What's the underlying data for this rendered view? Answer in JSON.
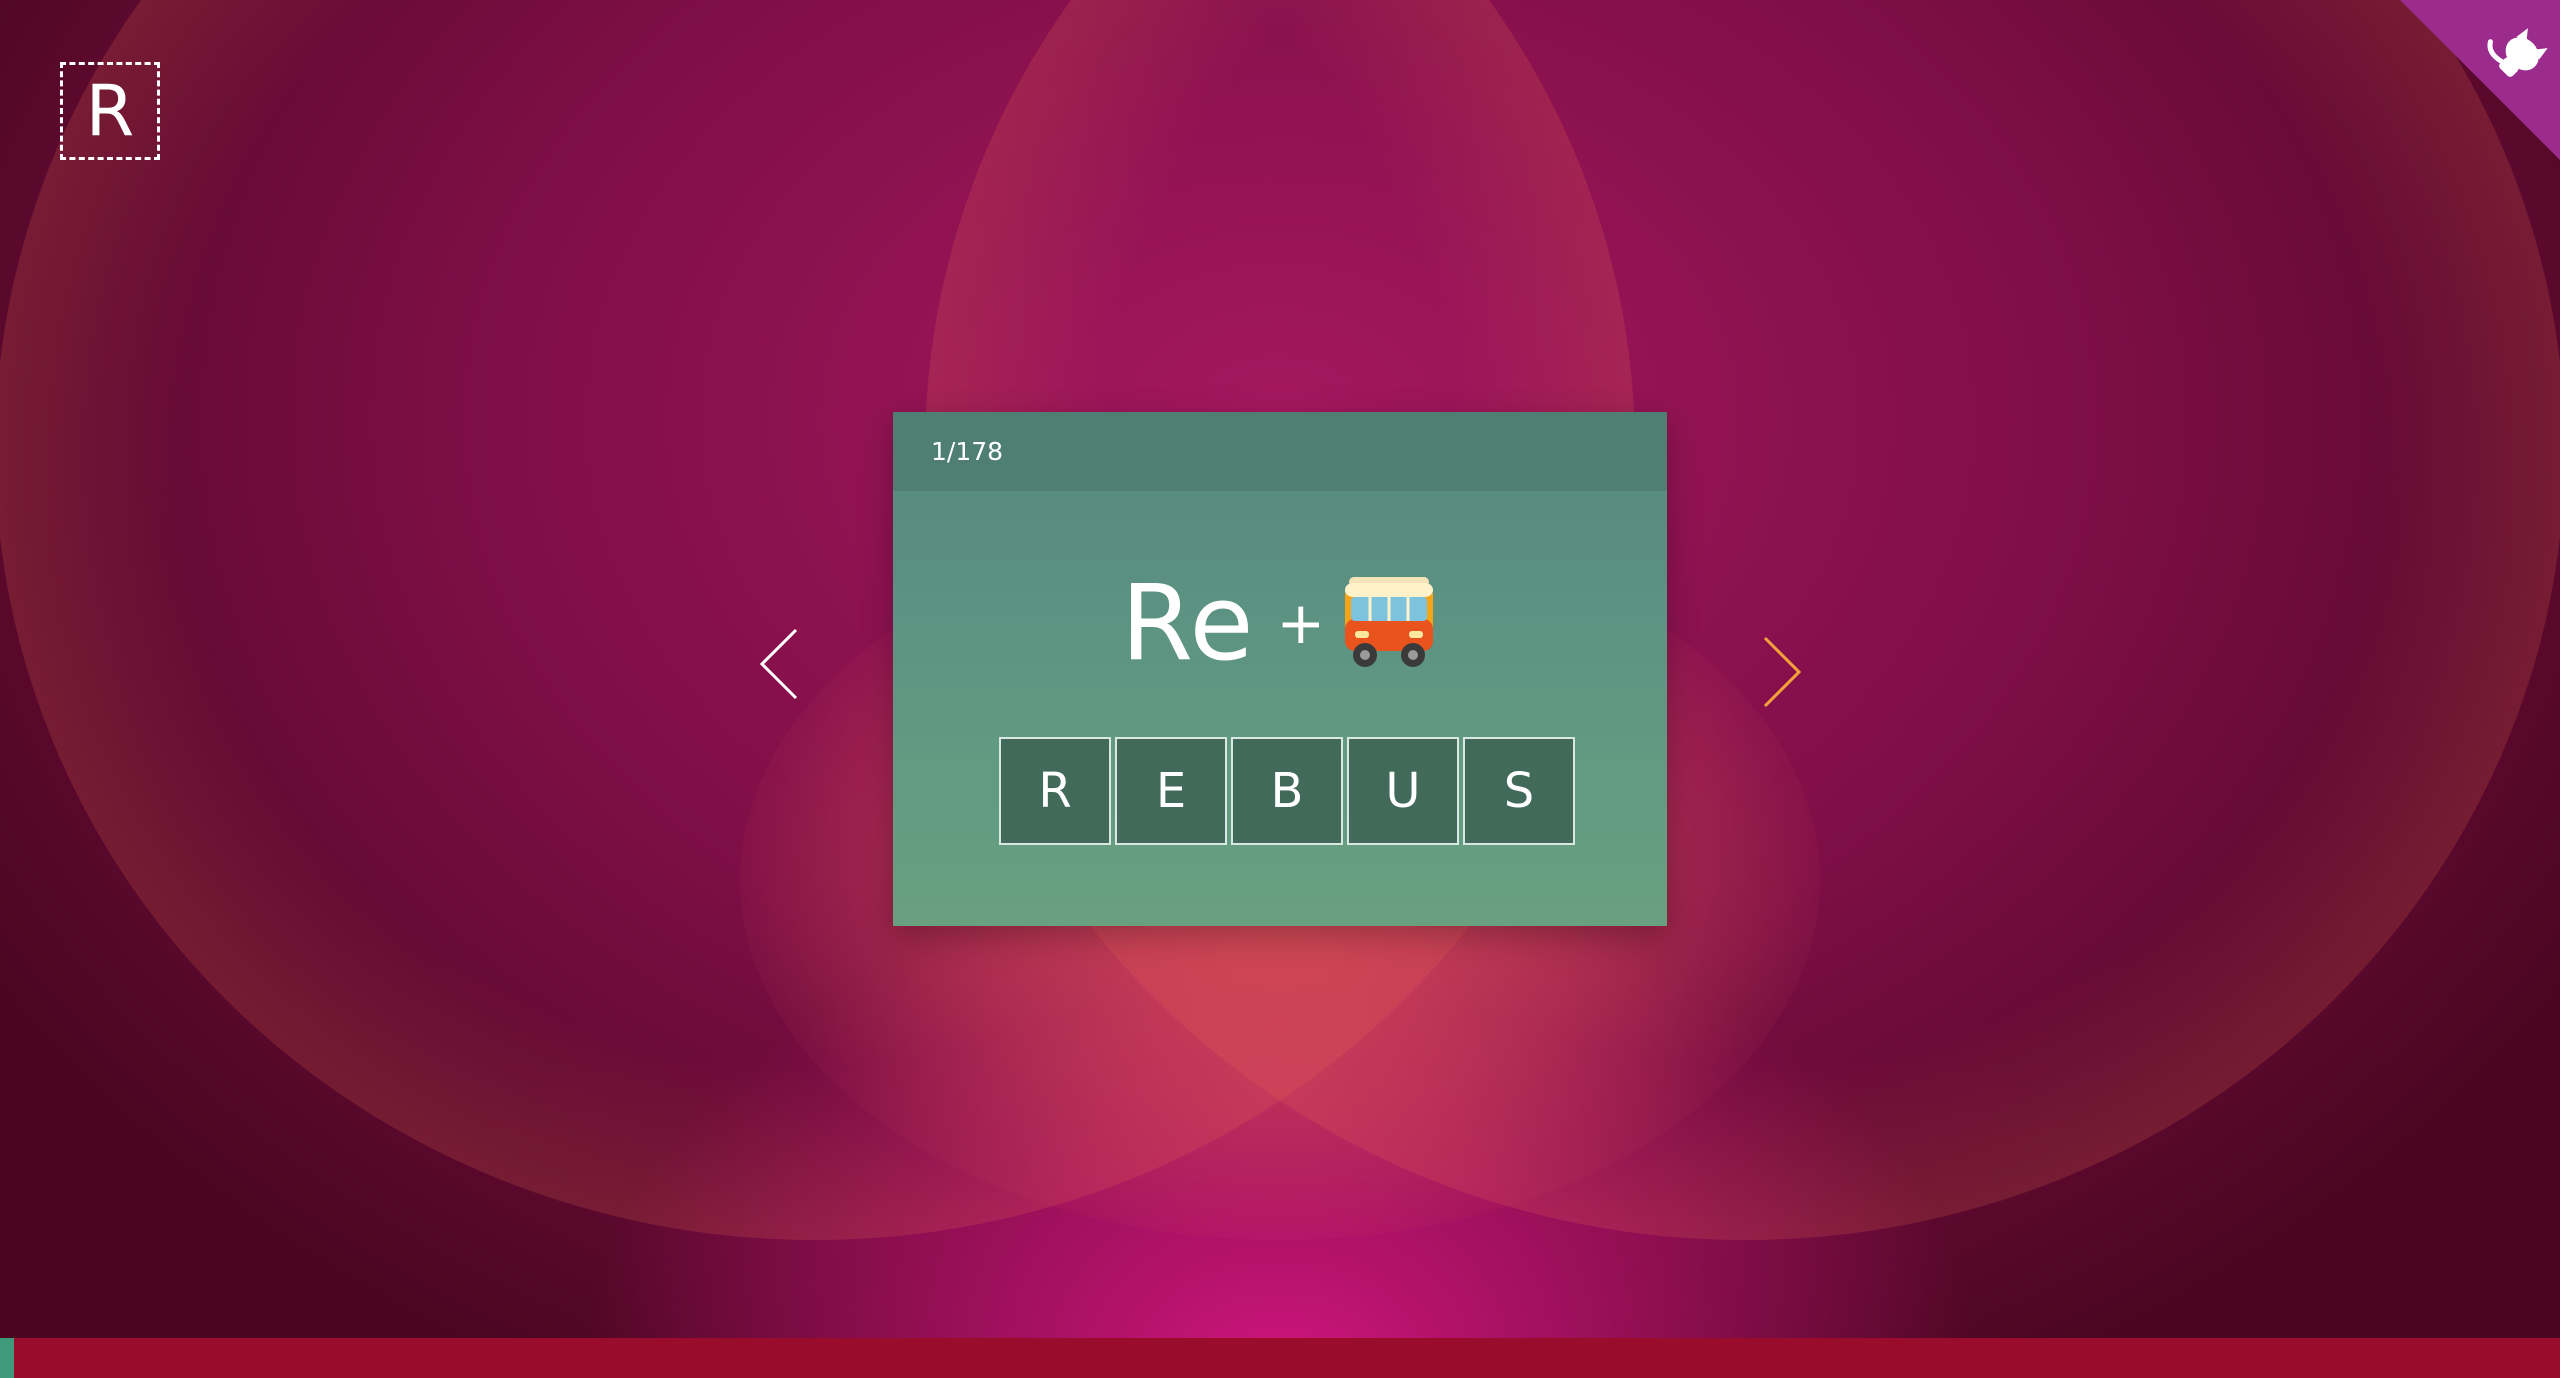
{
  "logo": {
    "letter": "R"
  },
  "card": {
    "counter": "1/178",
    "puzzle_word": "Re",
    "puzzle_operator": "+",
    "puzzle_icon": "bus-icon",
    "answer_letters": [
      "R",
      "E",
      "B",
      "U",
      "S"
    ]
  },
  "navigation": {
    "prev_icon": "chevron-left-icon",
    "next_icon": "chevron-right-icon"
  },
  "corner_icon": "github-octocat-icon",
  "progress": {
    "current": 1,
    "total": 178,
    "fraction": 0.0056
  },
  "colors": {
    "card": "#5f9783",
    "card_header": "#4f7f73",
    "answer_box": "#416a5a",
    "next_arrow": "#f2a33a",
    "corner": "#9b2b8c",
    "progress_track": "#9a0c2c",
    "progress_fill": "#3f9a7c"
  }
}
